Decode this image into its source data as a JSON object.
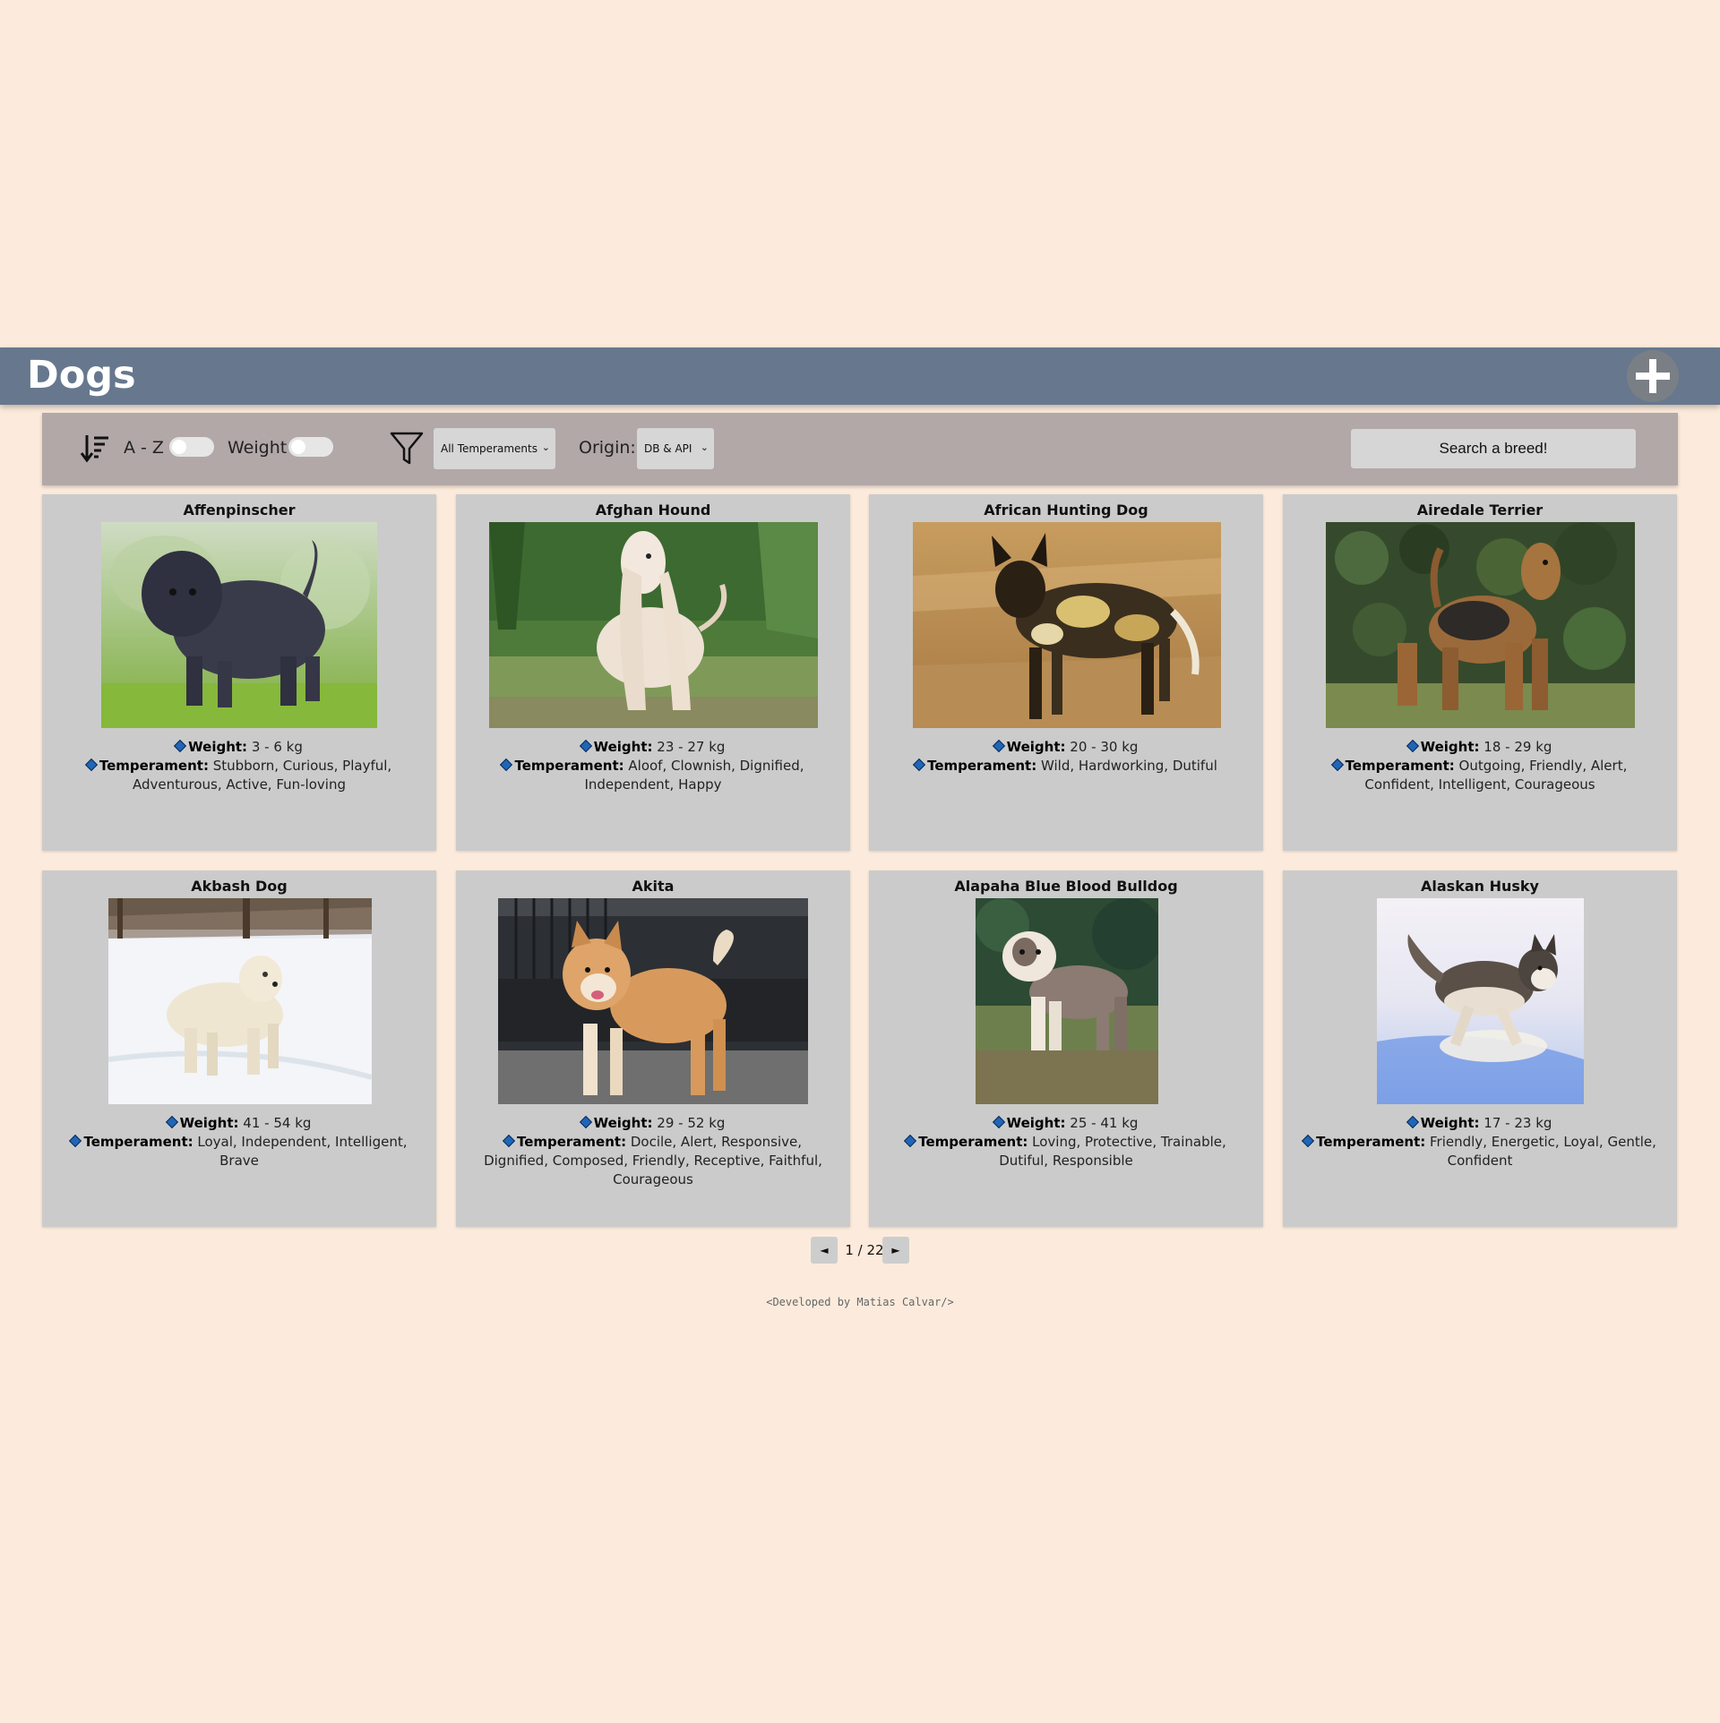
{
  "header": {
    "title": "Dogs",
    "add_icon": "plus-icon"
  },
  "toolbar": {
    "sort_icon": "sort-descending-icon",
    "az_label": "A - Z",
    "weight_label": "Weight",
    "filter_icon": "funnel-icon",
    "temperament_select": "All Temperaments",
    "origin_label": "Origin:",
    "origin_select": "DB & API",
    "search_placeholder": "Search a breed!"
  },
  "labels": {
    "weight": "Weight:",
    "temperament": "Temperament:"
  },
  "cards": [
    {
      "name": "Affenpinscher",
      "weight": "3 - 6 kg",
      "temperament": "Stubborn, Curious, Playful, Adventurous, Active, Fun-loving"
    },
    {
      "name": "Afghan Hound",
      "weight": "23 - 27 kg",
      "temperament": "Aloof, Clownish, Dignified, Independent, Happy"
    },
    {
      "name": "African Hunting Dog",
      "weight": "20 - 30 kg",
      "temperament": "Wild, Hardworking, Dutiful"
    },
    {
      "name": "Airedale Terrier",
      "weight": "18 - 29 kg",
      "temperament": "Outgoing, Friendly, Alert, Confident, Intelligent, Courageous"
    },
    {
      "name": "Akbash Dog",
      "weight": "41 - 54 kg",
      "temperament": "Loyal, Independent, Intelligent, Brave"
    },
    {
      "name": "Akita",
      "weight": "29 - 52 kg",
      "temperament": "Docile, Alert, Responsive, Dignified, Composed, Friendly, Receptive, Faithful, Courageous"
    },
    {
      "name": "Alapaha Blue Blood Bulldog",
      "weight": "25 - 41 kg",
      "temperament": "Loving, Protective, Trainable, Dutiful, Responsible"
    },
    {
      "name": "Alaskan Husky",
      "weight": "17 - 23 kg",
      "temperament": "Friendly, Energetic, Loyal, Gentle, Confident"
    }
  ],
  "pagination": {
    "prev": "◄",
    "next": "►",
    "page": "1 / 22"
  },
  "footer": {
    "text": "<Developed by Matias Calvar/>"
  }
}
